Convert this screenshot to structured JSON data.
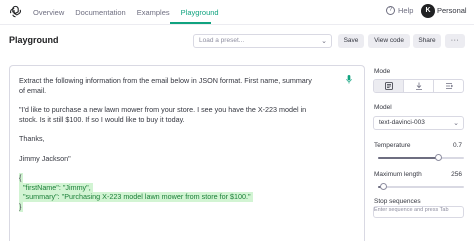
{
  "nav": {
    "links": [
      "Overview",
      "Documentation",
      "Examples",
      "Playground"
    ],
    "active": "Playground",
    "help_label": "Help",
    "avatar_initial": "K",
    "account_label": "Personal"
  },
  "header": {
    "title": "Playground",
    "preset_placeholder": "Load a preset...",
    "buttons": {
      "save": "Save",
      "view_code": "View code",
      "share": "Share",
      "more": "···"
    }
  },
  "editor": {
    "line1": "Extract the following information from the email below in JSON format. First name, summary",
    "line2": "of email.",
    "line3": "\"I'd like to purchase a new lawn mower from your store. I see you have the X-223 model in",
    "line4": "stock. Is it still $100. If so I would like to buy it today.",
    "line5": "Thanks,",
    "line6": "Jimmy Jackson\"",
    "out1": "{",
    "out2": "  \"firstName\": \"Jimmy\",",
    "out3": "  \"summary\": \"Purchasing X-223 model lawn mower from store for $100.\"",
    "out4": "}"
  },
  "panel": {
    "mode_label": "Mode",
    "mode_options": [
      "complete",
      "insert",
      "edit"
    ],
    "mode_active": "complete",
    "model_label": "Model",
    "model_value": "text-davinci-003",
    "temperature_label": "Temperature",
    "temperature_value": "0.7",
    "temperature_fraction": 0.7,
    "max_length_label": "Maximum length",
    "max_length_value": "256",
    "max_length_fraction": 0.06,
    "stop_label": "Stop sequences",
    "stop_hint": "Enter sequence and press Tab"
  },
  "colors": {
    "accent": "#10a37f",
    "highlight": "#d2f4d3",
    "key_text": "#1a7f37"
  }
}
